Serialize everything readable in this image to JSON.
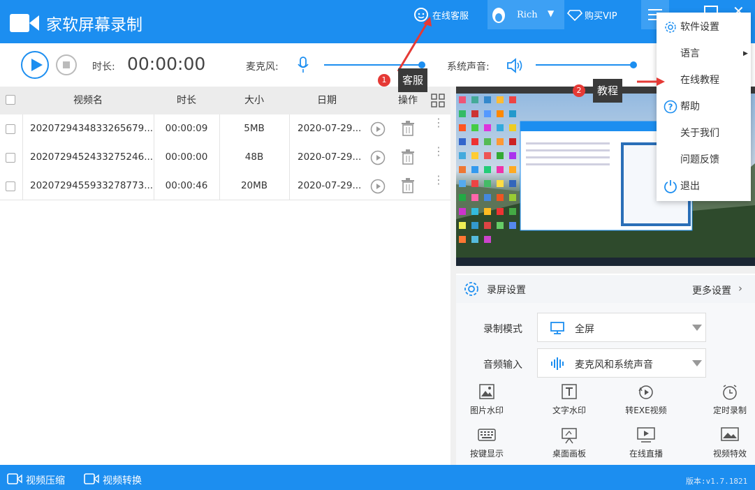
{
  "app": {
    "title": "家软屏幕录制"
  },
  "header": {
    "service": "在线客服",
    "user": "Rich",
    "vip": "购买VIP"
  },
  "toolbar": {
    "duration_label": "时长:",
    "duration_value": "00:00:00",
    "mic_label": "麦克风:",
    "system_label": "系统声音:"
  },
  "table": {
    "headers": [
      "视频名",
      "时长",
      "大小",
      "日期",
      "操作"
    ],
    "rows": [
      {
        "name": "2020729434833265679...",
        "duration": "00:00:09",
        "size": "5MB",
        "date": "2020-07-29..."
      },
      {
        "name": "2020729452433275246...",
        "duration": "00:00:00",
        "size": "48B",
        "date": "2020-07-29..."
      },
      {
        "name": "2020729455933278773...",
        "duration": "00:00:46",
        "size": "20MB",
        "date": "2020-07-29..."
      }
    ]
  },
  "menu": {
    "items": [
      "软件设置",
      "语言",
      "在线教程",
      "帮助",
      "关于我们",
      "问题反馈",
      "退出"
    ]
  },
  "callouts": {
    "one_num": "1",
    "one_label": "客服",
    "two_num": "2",
    "two_label": "教程"
  },
  "settings": {
    "title": "录屏设置",
    "more": "更多设置",
    "mode_label": "录制模式",
    "mode_value": "全屏",
    "audio_label": "音频输入",
    "audio_value": "麦克风和系统声音",
    "tools": [
      "图片水印",
      "文字水印",
      "转EXE视频",
      "定时录制",
      "按键显示",
      "桌面画板",
      "在线直播",
      "视频特效"
    ]
  },
  "bottom": {
    "compress": "视频压缩",
    "convert": "视频转换",
    "version": "版本:v1.7.1821"
  },
  "colors": {
    "brand": "#1c8ef0",
    "callout": "#3a3a3a",
    "badge": "#e53935",
    "arrow": "#e53935"
  }
}
